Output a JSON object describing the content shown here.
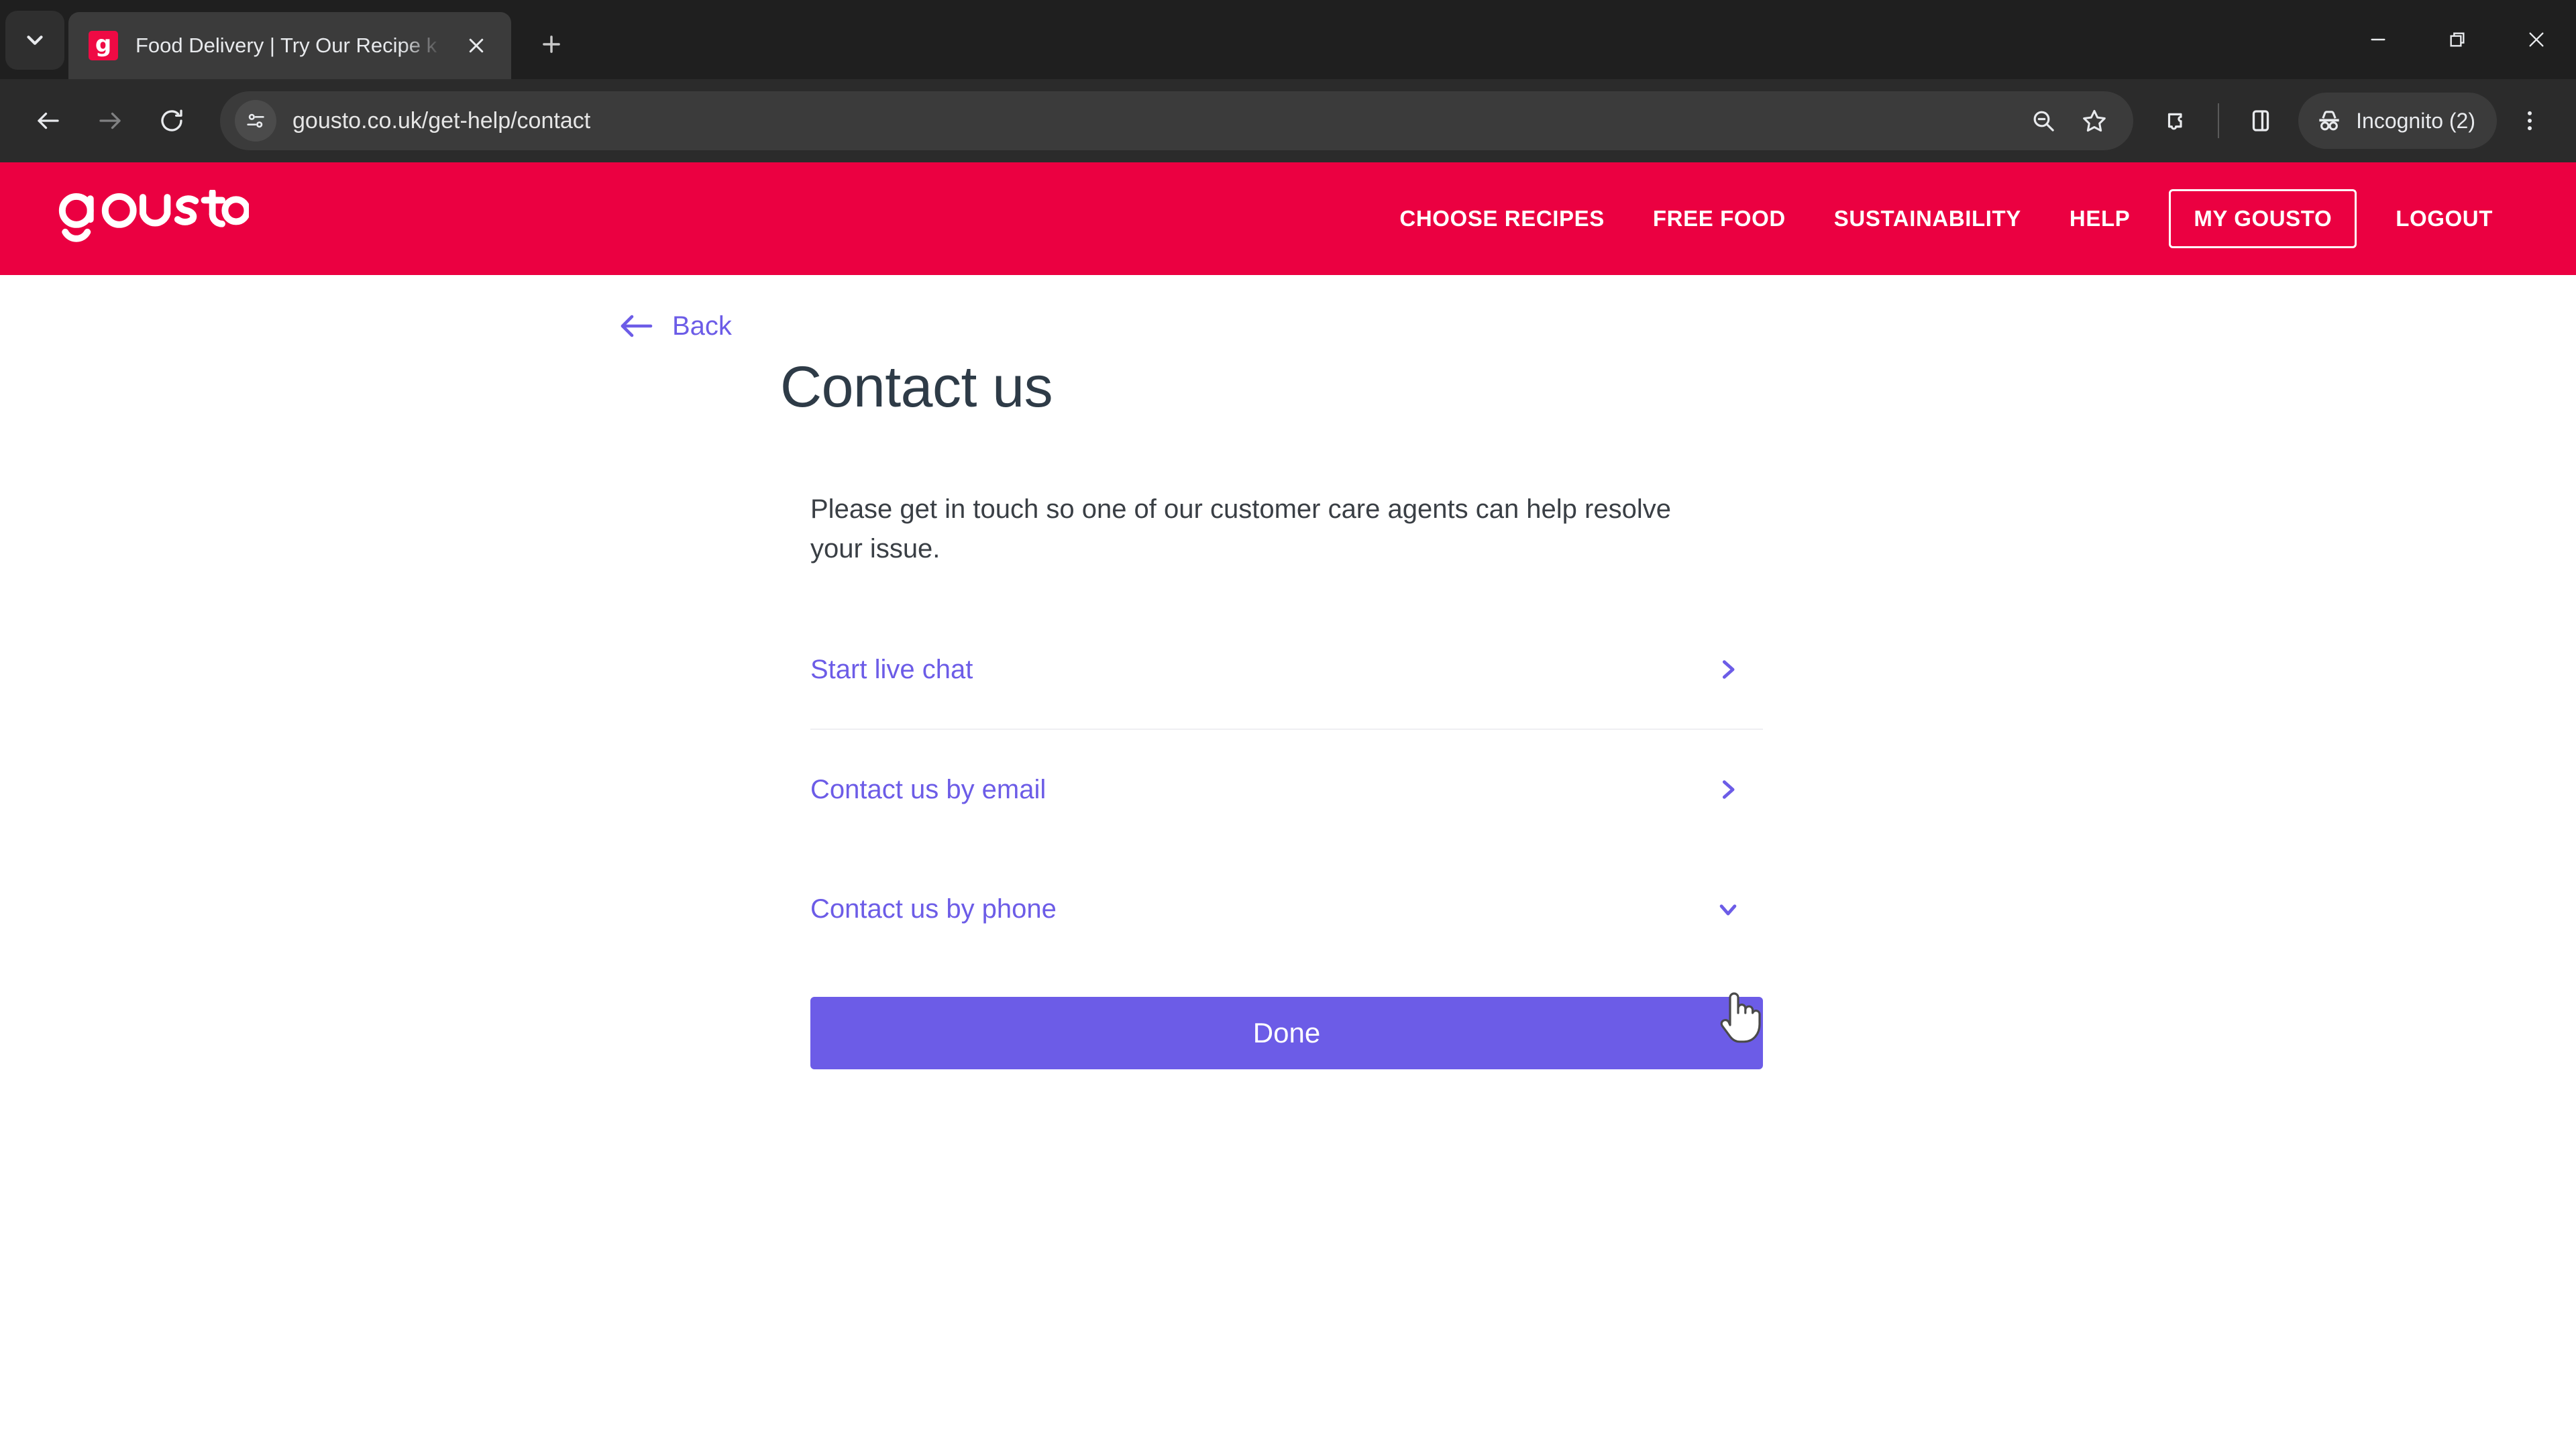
{
  "browser": {
    "tab": {
      "title": "Food Delivery | Try Our Recipe k",
      "favicon_letter": "g",
      "favicon_color": "#ef0a44",
      "close_icon": "close-icon"
    },
    "tab_search_icon": "chevron-down-icon",
    "new_tab_icon": "plus-icon",
    "window_controls": {
      "minimize": "minimize-icon",
      "restore": "restore-icon",
      "close": "close-icon"
    },
    "toolbar": {
      "back_icon": "arrow-left-icon",
      "forward_icon": "arrow-right-icon",
      "reload_icon": "reload-icon",
      "site_info_icon": "tune-icon",
      "url": "gousto.co.uk/get-help/contact",
      "zoom_icon": "zoom-out-icon",
      "bookmark_icon": "star-icon",
      "extensions_icon": "puzzle-icon",
      "side_panel_icon": "side-panel-icon",
      "incognito_label": "Incognito (2)",
      "incognito_icon": "incognito-icon",
      "menu_icon": "three-dot-menu-icon"
    }
  },
  "site": {
    "brand": "gousto",
    "brand_color": "#EB0041",
    "accent_color": "#6C5CE7",
    "nav": [
      {
        "label": "CHOOSE RECIPES"
      },
      {
        "label": "FREE FOOD"
      },
      {
        "label": "SUSTAINABILITY"
      },
      {
        "label": "HELP"
      }
    ],
    "nav_button": "MY GOUSTO",
    "nav_logout": "LOGOUT"
  },
  "page": {
    "back_label": "Back",
    "title": "Contact us",
    "intro": "Please get in touch so one of our customer care agents can help resolve your issue.",
    "options": [
      {
        "label": "Start live chat",
        "icon": "chevron-right-icon"
      },
      {
        "label": "Contact us by email",
        "icon": "chevron-right-icon"
      },
      {
        "label": "Contact us by phone",
        "icon": "chevron-down-icon"
      }
    ],
    "done_label": "Done"
  }
}
